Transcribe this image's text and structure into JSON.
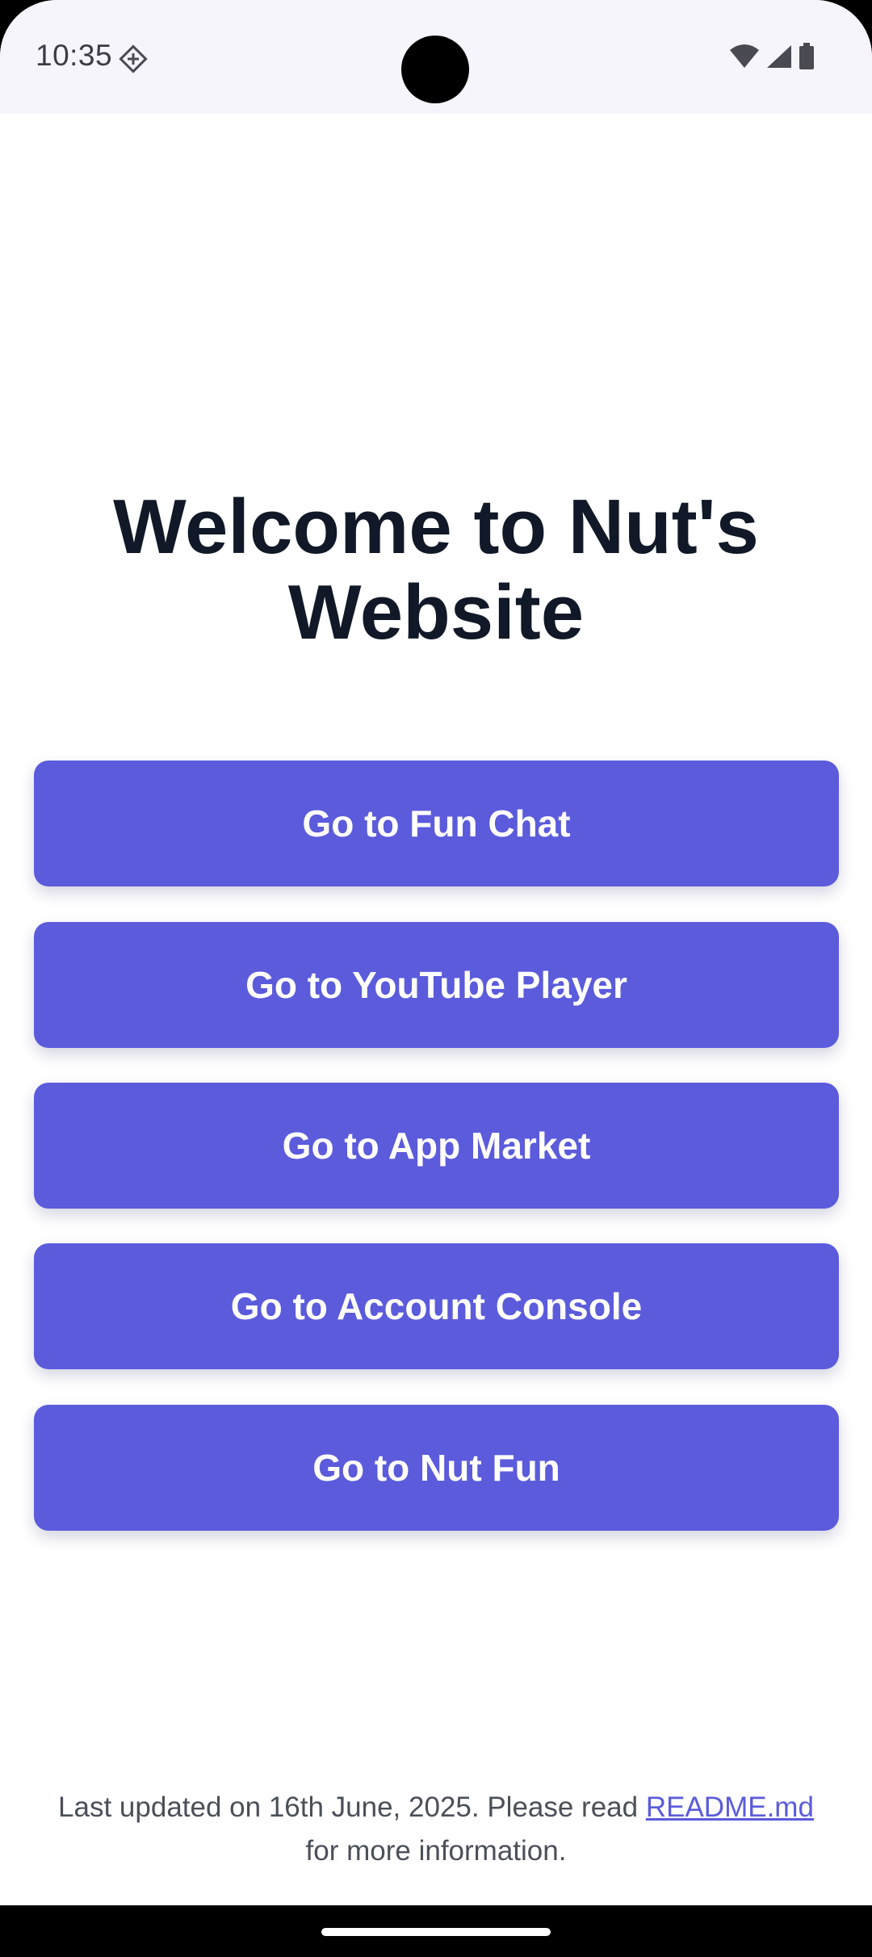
{
  "status_bar": {
    "time": "10:35",
    "icons": [
      "app-notification-icon",
      "wifi-icon",
      "signal-icon",
      "battery-icon"
    ]
  },
  "main": {
    "title_line1": "Welcome to Nut's",
    "title_line2": "Website",
    "buttons": [
      {
        "label": "Go to Fun Chat"
      },
      {
        "label": "Go to YouTube Player"
      },
      {
        "label": "Go to App Market"
      },
      {
        "label": "Go to Account Console"
      },
      {
        "label": "Go to Nut Fun"
      }
    ]
  },
  "footer": {
    "text_before": "Last updated on 16th June, 2025. Please read ",
    "link": "README.md",
    "text_after": "for more information."
  },
  "colors": {
    "accent": "#5b5bdc",
    "title": "#111827",
    "status_bar_bg": "#f7f5fc"
  }
}
